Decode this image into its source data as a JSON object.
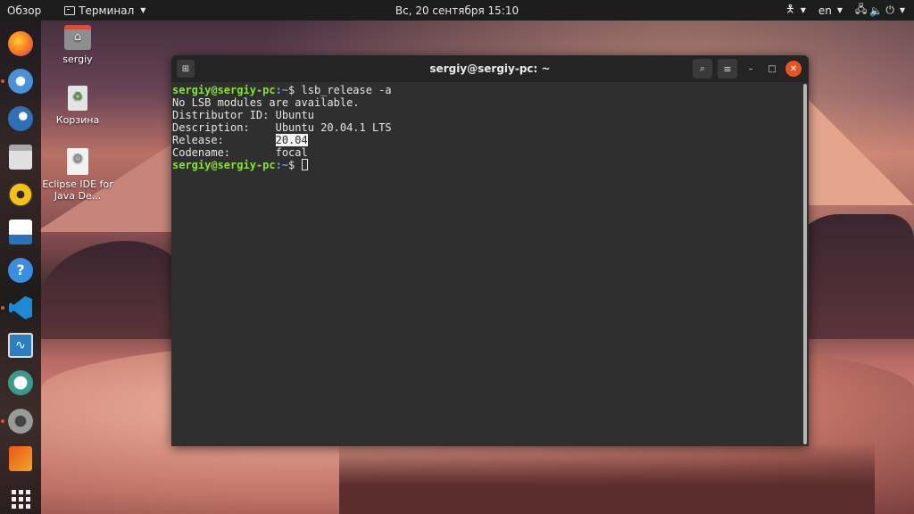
{
  "topbar": {
    "activities": "Обзор",
    "app_name": "Терминал",
    "clock": "Вс, 20 сентября  15:10",
    "language": "en"
  },
  "dock": {
    "items": [
      {
        "name": "firefox",
        "color": "#e66000"
      },
      {
        "name": "chromium",
        "color": "#4a90d9"
      },
      {
        "name": "thunderbird",
        "color": "#2f6fb7"
      },
      {
        "name": "files",
        "color": "#d8d8d8"
      },
      {
        "name": "rhythmbox",
        "color": "#f5c211"
      },
      {
        "name": "libreoffice-writer",
        "color": "#2a71b8"
      },
      {
        "name": "help",
        "color": "#3a8de0"
      },
      {
        "name": "vscode",
        "color": "#1e8ad6"
      },
      {
        "name": "system-monitor",
        "color": "#2b7fc0"
      },
      {
        "name": "remmina",
        "color": "#3b9a8e"
      },
      {
        "name": "settings",
        "color": "#8a8a8a"
      },
      {
        "name": "ubuntu-software",
        "color": "#e95420"
      }
    ]
  },
  "desktop": {
    "home_label": "sergiy",
    "trash_label": "Корзина",
    "eclipse_label": "Eclipse IDE for Java De..."
  },
  "terminal": {
    "title": "sergiy@sergiy-pc: ~",
    "prompt_user": "sergiy@sergiy-pc",
    "prompt_path": ":~",
    "prompt_symbol": "$ ",
    "command": "lsb_release -a",
    "output": [
      "No LSB modules are available.",
      "Distributor ID: Ubuntu",
      "Description:    Ubuntu 20.04.1 LTS"
    ],
    "release_label": "Release:        ",
    "release_value": "20.04",
    "codename_line": "Codename:       focal"
  }
}
